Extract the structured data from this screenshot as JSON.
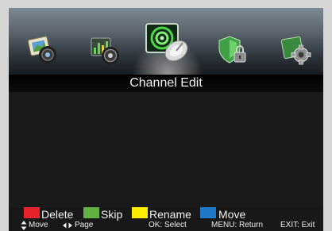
{
  "menu": {
    "items": [
      {
        "icon": "picture-icon",
        "selected": false
      },
      {
        "icon": "sound-equalizer-icon",
        "selected": false
      },
      {
        "icon": "channel-satellite-icon",
        "selected": true
      },
      {
        "icon": "lock-shield-icon",
        "selected": false
      },
      {
        "icon": "settings-gear-icon",
        "selected": false
      }
    ]
  },
  "title": "Channel Edit",
  "legend": {
    "delete": {
      "label": "Delete",
      "color": "#e8232b"
    },
    "skip": {
      "label": "Skip",
      "color": "#63b043"
    },
    "rename": {
      "label": "Rename",
      "color": "#ffee00"
    },
    "move": {
      "label": "Move",
      "color": "#1f78c8"
    }
  },
  "hints": {
    "move": "Move",
    "page": "Page",
    "ok": "OK: Select",
    "menu": "MENU: Return",
    "exit": "EXIT: Exit"
  }
}
